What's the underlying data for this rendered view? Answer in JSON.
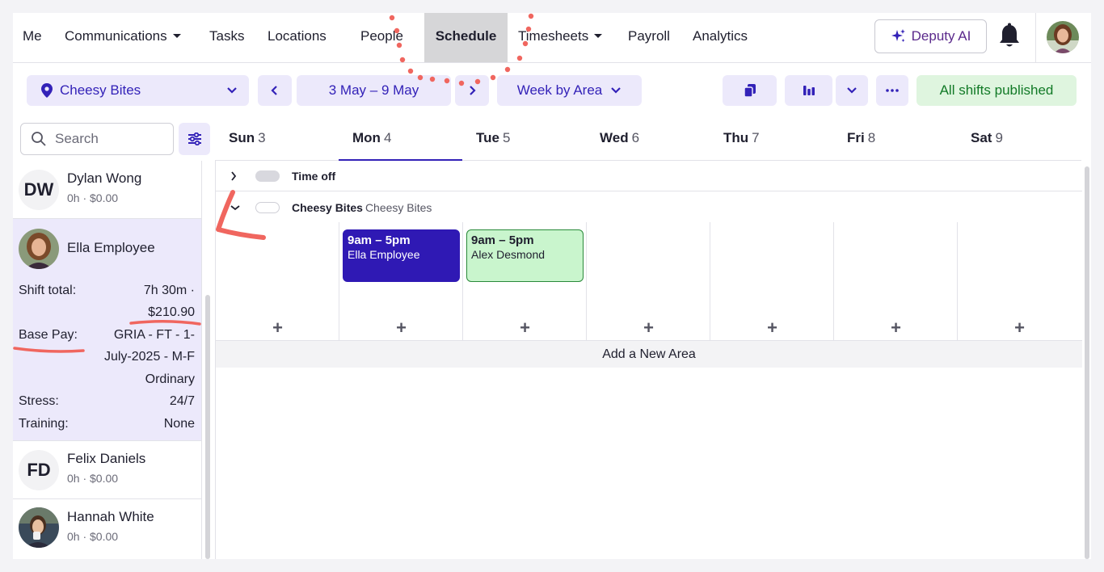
{
  "nav": {
    "items": [
      {
        "label": "Me",
        "dropdown": false
      },
      {
        "label": "Communications",
        "dropdown": true
      },
      {
        "label": "Tasks",
        "dropdown": false
      },
      {
        "label": "Locations",
        "dropdown": false
      },
      {
        "label": "People",
        "dropdown": false
      },
      {
        "label": "Schedule",
        "dropdown": false,
        "active": true
      },
      {
        "label": "Timesheets",
        "dropdown": true
      },
      {
        "label": "Payroll",
        "dropdown": false
      },
      {
        "label": "Analytics",
        "dropdown": false
      }
    ],
    "ai_button": "Deputy AI",
    "icons": {
      "ai": "sparkle-icon",
      "bell": "bell-icon",
      "avatar": "user-avatar"
    }
  },
  "toolbar": {
    "location": "Cheesy Bites",
    "date_range": "3 May – 9 May",
    "view": "Week by Area",
    "status": "All shifts published",
    "icons": [
      "map-pin-icon",
      "chevron-down-icon",
      "chevron-left-icon",
      "chevron-right-icon",
      "copy-icon",
      "bar-chart-icon",
      "more-icon"
    ]
  },
  "search": {
    "placeholder": "Search"
  },
  "days": [
    {
      "name": "Sun",
      "num": "3"
    },
    {
      "name": "Mon",
      "num": "4",
      "active": true
    },
    {
      "name": "Tue",
      "num": "5"
    },
    {
      "name": "Wed",
      "num": "6"
    },
    {
      "name": "Thu",
      "num": "7"
    },
    {
      "name": "Fri",
      "num": "8"
    },
    {
      "name": "Sat",
      "num": "9"
    }
  ],
  "employees": [
    {
      "initials": "DW",
      "name": "Dylan Wong",
      "summary": "0h · $0.00"
    },
    {
      "name": "Ella Employee",
      "selected": true,
      "details": {
        "shift_total_label": "Shift total:",
        "shift_total_value": "7h 30m ·",
        "shift_total_amount": "$210.90",
        "base_pay_label": "Base Pay:",
        "base_pay_line1": "GRIA - FT - 1-",
        "base_pay_line2": "July-2025 - M-F",
        "base_pay_line3": "Ordinary",
        "stress_label": "Stress:",
        "stress_value": "24/7",
        "training_label": "Training:",
        "training_value": "None"
      }
    },
    {
      "initials": "FD",
      "name": "Felix Daniels",
      "summary": "0h · $0.00"
    },
    {
      "name": "Hannah White",
      "summary": "0h · $0.00"
    }
  ],
  "grid": {
    "time_off_label": "Time off",
    "area_name": "Cheesy Bites",
    "area_location": "Cheesy Bites",
    "shifts": [
      {
        "day_index": 1,
        "time": "9am – 5pm",
        "employee": "Ella Employee",
        "bg": "#2f19b4",
        "fg": "#ffffff",
        "border": "#2f19b4"
      },
      {
        "day_index": 2,
        "time": "9am – 5pm",
        "employee": "Alex Desmond",
        "bg": "#c9f5cd",
        "fg": "#1f1f2e",
        "border": "#2a8a3a"
      }
    ],
    "add_symbol": "+",
    "add_area": "Add a New Area"
  },
  "colors": {
    "accent": "#3322b8",
    "accent_bg": "#ece9fb",
    "success_bg": "#dff5df",
    "success_fg": "#127a27",
    "annotation": "#f0665f"
  }
}
